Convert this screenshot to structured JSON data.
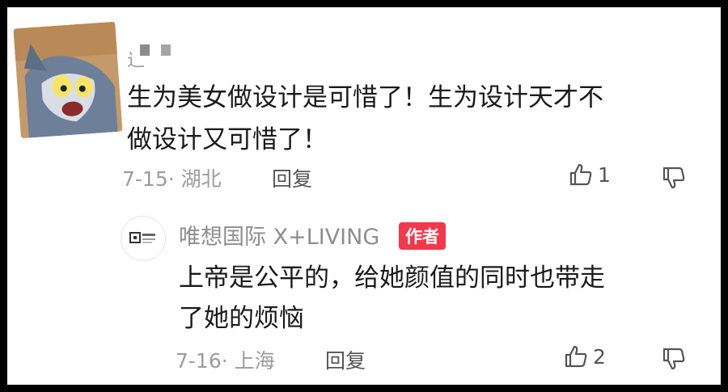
{
  "comment": {
    "username": "辶",
    "text_line1": "生为美女做设计是可惜了！生为设计天才不",
    "text_line2": "做设计又可惜了！",
    "date_location": "7-15· 湖北",
    "reply_label": "回复",
    "like_count": "1"
  },
  "reply": {
    "author": "唯想国际 X+LIVING",
    "badge": "作者",
    "text_line1": "上帝是公平的，给她颜值的同时也带走",
    "text_line2": "了她的烦恼",
    "date_location": "7-16· 上海",
    "reply_label": "回复",
    "like_count": "2"
  },
  "colors": {
    "badge": "#f0394a",
    "meta": "#9c9c9c",
    "text": "#1a1a1a"
  },
  "icons": {
    "like": "thumbs-up-icon",
    "dislike": "thumbs-down-icon"
  }
}
